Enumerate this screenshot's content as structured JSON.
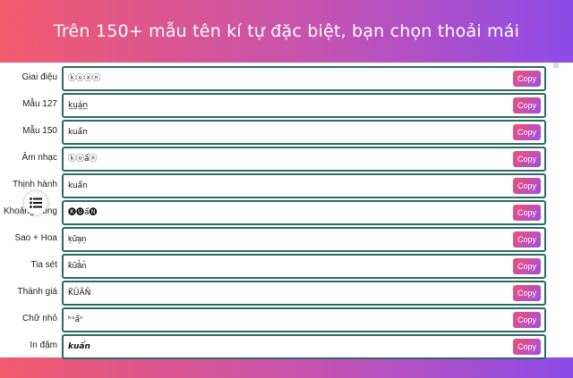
{
  "banner": {
    "title": "Trên 150+ mẫu tên kí tự đặc biệt, bạn chọn thoải mái"
  },
  "copy_label": "Copy",
  "rows": [
    {
      "label": "Giai điệu",
      "value": "ⓚⓤⓐⓝ"
    },
    {
      "label": "Mẫu 127",
      "value": "k̲u̲ả̲n̲"
    },
    {
      "label": "Mẫu 150",
      "value": "kuẩn"
    },
    {
      "label": "Âm nhạc",
      "value": "ⓚⓤẩⓝ"
    },
    {
      "label": "Thịnh hành",
      "value": "kuẩn"
    },
    {
      "label": "Khoảng trống",
      "value": "🅚🅤ẩ🅝"
    },
    {
      "label": "Sao + Hoa",
      "value": "k͙ữa͙n͙"
    },
    {
      "label": "Tia sét",
      "value": "k͛ữâ͛n͛"
    },
    {
      "label": "Thánh giá",
      "value": "K̃ŨÃÑ"
    },
    {
      "label": "Chữ nhỏ",
      "value": "ᵏᵘẩⁿ"
    },
    {
      "label": "In đậm",
      "value": "kuẩn"
    }
  ],
  "colors": {
    "gradient_start": "#f25a6e",
    "gradient_end": "#8e4be8",
    "box_border": "#2a6b62",
    "button_text": "#ffffff"
  },
  "icons": {
    "floating_menu": "list-icon"
  }
}
